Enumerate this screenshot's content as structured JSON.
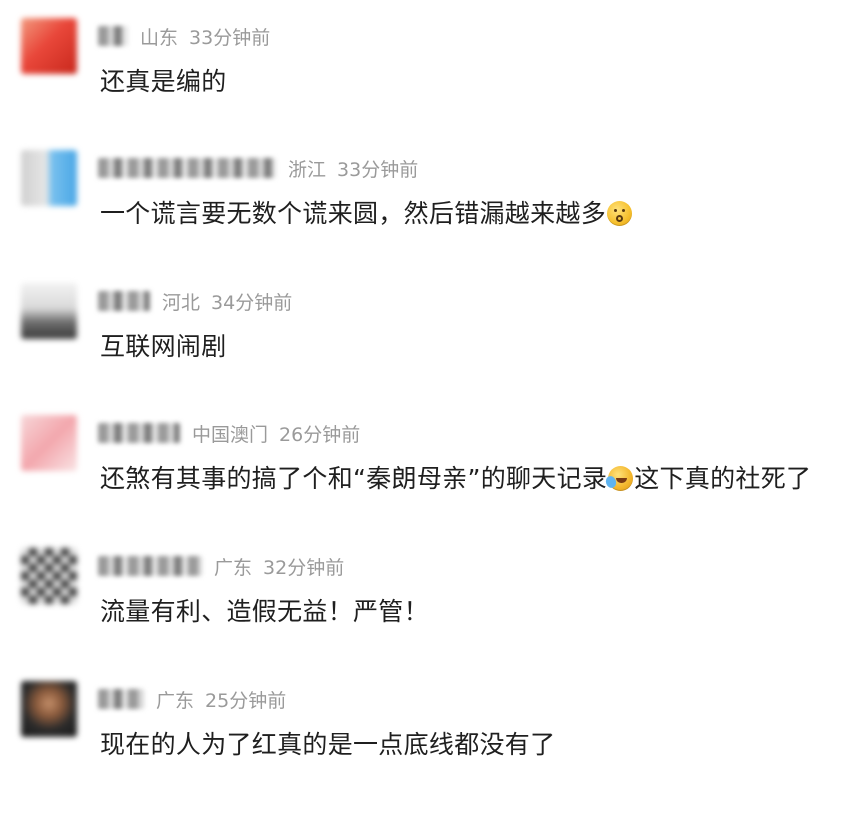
{
  "comments": [
    {
      "region": "山东",
      "time": "33分钟前",
      "text": "还真是编的",
      "avatar_colors": [
        "#e9473a",
        "#f08c6a"
      ]
    },
    {
      "region": "浙江",
      "time": "33分钟前",
      "text": "一个谎言要无数个谎来圆，然后错漏越来越多",
      "emoji": "whistle-face-emoji",
      "avatar_colors": [
        "#7ec3ef",
        "#c9c9c9"
      ]
    },
    {
      "region": "河北",
      "time": "34分钟前",
      "text": "互联网闹剧",
      "avatar_colors": [
        "#bdbdbd",
        "#4a4a4a"
      ]
    },
    {
      "region": "中国澳门",
      "time": "26分钟前",
      "text_before": "还煞有其事的搞了个和“秦朗母亲”的聊天记录",
      "emoji": "crying-face-emoji",
      "text_after": "这下真的社死了",
      "avatar_colors": [
        "#f3a7ad",
        "#f7d1d4"
      ]
    },
    {
      "region": "广东",
      "time": "32分钟前",
      "text": "流量有利、造假无益！严管！",
      "avatar_colors": [
        "#5a5a5a",
        "#d9d9d9"
      ]
    },
    {
      "region": "广东",
      "time": "25分钟前",
      "text": "现在的人为了红真的是一点底线都没有了",
      "avatar_colors": [
        "#2b2b2b",
        "#c48f6a"
      ]
    }
  ]
}
